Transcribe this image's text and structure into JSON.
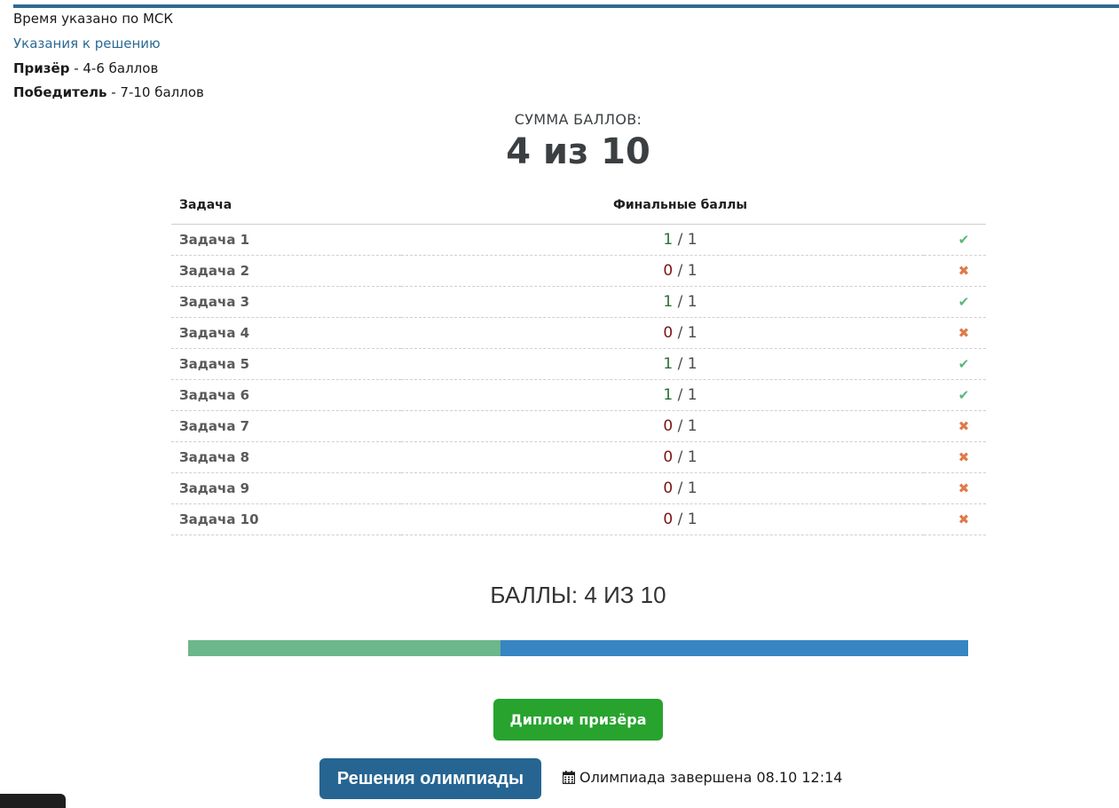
{
  "header": {
    "time_note": "Время указано по МСК",
    "hint_link": "Указания к решению",
    "prize_label": "Призёр",
    "prize_range": " - 4-6 баллов",
    "winner_label": "Победитель",
    "winner_range": " - 7-10 баллов"
  },
  "summary": {
    "caption": "СУММА БАЛЛОВ:",
    "value": "4 из 10"
  },
  "table": {
    "col_task": "Задача",
    "col_score": "Финальные баллы",
    "rows": [
      {
        "task": "Задача 1",
        "got": "1",
        "max": " / 1",
        "status": "ok"
      },
      {
        "task": "Задача 2",
        "got": "0",
        "max": " / 1",
        "status": "fail"
      },
      {
        "task": "Задача 3",
        "got": "1",
        "max": " / 1",
        "status": "ok"
      },
      {
        "task": "Задача 4",
        "got": "0",
        "max": " / 1",
        "status": "fail"
      },
      {
        "task": "Задача 5",
        "got": "1",
        "max": " / 1",
        "status": "ok"
      },
      {
        "task": "Задача 6",
        "got": "1",
        "max": " / 1",
        "status": "ok"
      },
      {
        "task": "Задача 7",
        "got": "0",
        "max": " / 1",
        "status": "fail"
      },
      {
        "task": "Задача 8",
        "got": "0",
        "max": " / 1",
        "status": "fail"
      },
      {
        "task": "Задача 9",
        "got": "0",
        "max": " / 1",
        "status": "fail"
      },
      {
        "task": "Задача 10",
        "got": "0",
        "max": " / 1",
        "status": "fail"
      }
    ]
  },
  "points": {
    "caption": "БАЛЛЫ: 4 ИЗ 10",
    "progress_fraction": 0.4
  },
  "buttons": {
    "diploma": "Диплом призёра",
    "solutions": "Решения олимпиады"
  },
  "footer": {
    "finished_note": "Олимпиада завершена 08.10 12:14"
  },
  "colors": {
    "accent": "#2f6a91",
    "ok": "#5cb87a",
    "fail": "#e07a4a",
    "progress_done": "#6cb78b",
    "progress_rest": "#3785c2",
    "diploma_button": "#27a32e",
    "solutions_button": "#266592"
  },
  "icons": {
    "ok": "check-icon",
    "fail": "cross-icon",
    "calendar": "calendar-icon"
  }
}
